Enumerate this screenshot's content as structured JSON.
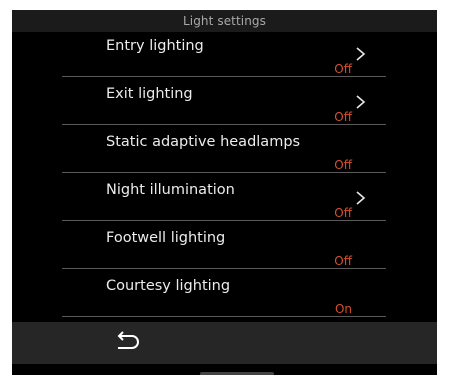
{
  "header": {
    "title": "Light settings"
  },
  "settings": {
    "items": [
      {
        "label": "Entry lighting",
        "value": "Off",
        "has_submenu": true
      },
      {
        "label": "Exit lighting",
        "value": "Off",
        "has_submenu": true
      },
      {
        "label": "Static adaptive headlamps",
        "value": "Off",
        "has_submenu": false
      },
      {
        "label": "Night illumination",
        "value": "Off",
        "has_submenu": true
      },
      {
        "label": "Footwell lighting",
        "value": "Off",
        "has_submenu": false
      },
      {
        "label": "Courtesy lighting",
        "value": "On",
        "has_submenu": false
      }
    ]
  },
  "toolbar": {
    "back_icon": "back-arrow-icon"
  },
  "colors": {
    "value_accent": "#d2502d",
    "background": "#000000",
    "label": "#ececec"
  }
}
